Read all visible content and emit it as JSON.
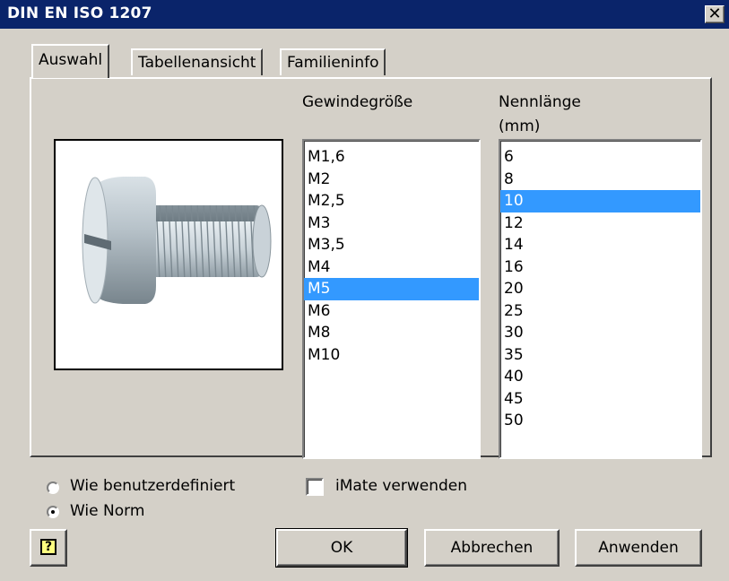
{
  "window": {
    "title": "DIN EN ISO 1207",
    "close_label": "✕"
  },
  "tabs": [
    {
      "label": "Auswahl",
      "active": true
    },
    {
      "label": "Tabellenansicht",
      "active": false
    },
    {
      "label": "Familieninfo",
      "active": false
    }
  ],
  "thread_size": {
    "header": "Gewindegröße",
    "items": [
      "M1,6",
      "M2",
      "M2,5",
      "M3",
      "M3,5",
      "M4",
      "M5",
      "M6",
      "M8",
      "M10"
    ],
    "selected": "M5"
  },
  "nominal_length": {
    "header_line1": "Nennlänge",
    "header_line2": "(mm)",
    "items": [
      "6",
      "8",
      "10",
      "12",
      "14",
      "16",
      "20",
      "25",
      "30",
      "35",
      "40",
      "45",
      "50"
    ],
    "selected": "10"
  },
  "options": {
    "radio_custom": "Wie benutzerdefiniert",
    "radio_norm": "Wie Norm",
    "radio_selected": "Wie Norm",
    "imate_label": "iMate verwenden",
    "imate_checked": false
  },
  "buttons": {
    "help_icon": "?",
    "ok": "OK",
    "cancel": "Abbrechen",
    "apply": "Anwenden"
  },
  "colors": {
    "titlebar": "#0a246a",
    "selection": "#3399ff",
    "face": "#d4d0c8"
  }
}
